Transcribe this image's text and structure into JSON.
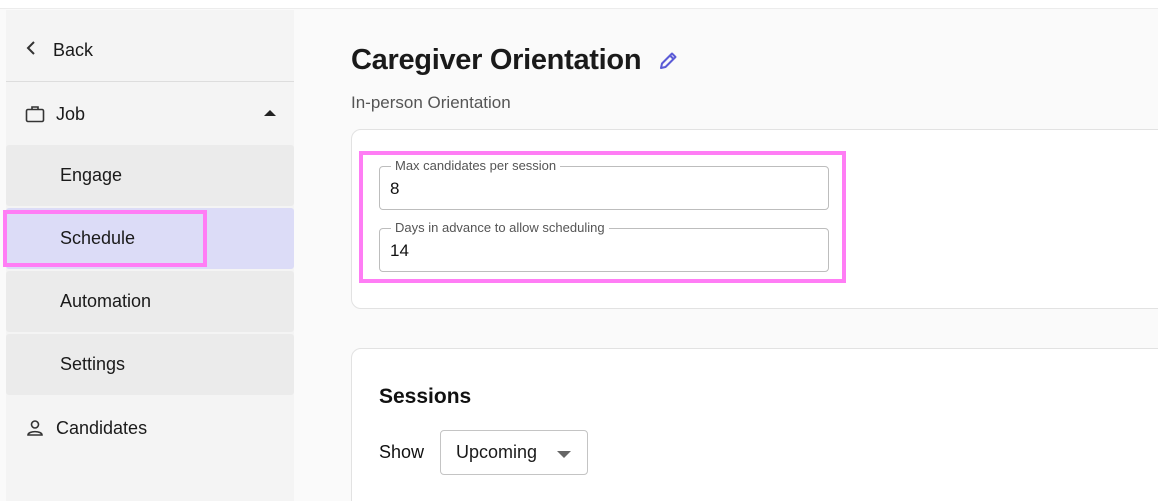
{
  "sidebar": {
    "back_label": "Back",
    "job_label": "Job",
    "subitems": {
      "engage": "Engage",
      "schedule": "Schedule",
      "automation": "Automation",
      "settings": "Settings"
    },
    "candidates_label": "Candidates",
    "active_item": "Schedule"
  },
  "main": {
    "title": "Caregiver Orientation",
    "subtitle": "In-person Orientation",
    "max_candidates": {
      "label": "Max candidates per session",
      "value": "8"
    },
    "days_advance": {
      "label": "Days in advance to allow scheduling",
      "value": "14"
    },
    "sessions": {
      "title": "Sessions",
      "show_label": "Show",
      "filter_value": "Upcoming"
    }
  },
  "colors": {
    "active_bg": "#dcdcf7",
    "highlight": "#ff7df5",
    "edit_icon": "#5b5bd6"
  },
  "icons": {
    "back": "chevron-left-icon",
    "job": "briefcase-icon",
    "job_toggle": "caret-up-icon",
    "candidates": "person-icon",
    "edit": "pencil-icon",
    "filter": "caret-down-icon"
  }
}
